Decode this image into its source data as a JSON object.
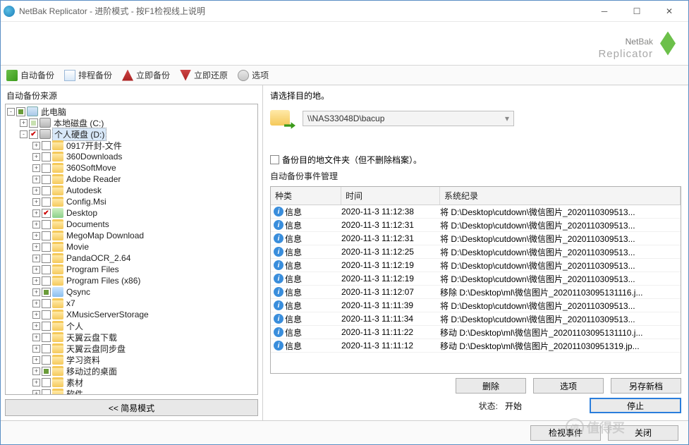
{
  "window": {
    "title": "NetBak Replicator - 进阶模式 - 按F1检视线上说明"
  },
  "brand": {
    "line1a": "Net",
    "line1b": "Bak",
    "line2": "Replicator"
  },
  "toolbar": {
    "auto": "自动备份",
    "sched": "排程备份",
    "now": "立即备份",
    "restore": "立即还原",
    "options": "选项"
  },
  "left": {
    "header": "自动备份来源",
    "simple_button": "<< 简易模式",
    "tree": {
      "root": "此电脑",
      "drives": [
        {
          "label": "本地磁盘 (C:)",
          "exp": "+",
          "cb": "light"
        },
        {
          "label": "个人硬盘 (D:)",
          "exp": "-",
          "cb": "checked",
          "sel": true,
          "children": [
            {
              "label": "0917开封-文件",
              "cb": "",
              "icon": "folder"
            },
            {
              "label": "360Downloads",
              "cb": "",
              "icon": "folder"
            },
            {
              "label": "360SoftMove",
              "cb": "",
              "icon": "folder"
            },
            {
              "label": "Adobe Reader",
              "cb": "",
              "icon": "folder"
            },
            {
              "label": "Autodesk",
              "cb": "",
              "icon": "folder"
            },
            {
              "label": "Config.Msi",
              "cb": "",
              "icon": "folder"
            },
            {
              "label": "Desktop",
              "cb": "checked",
              "icon": "foldergreen"
            },
            {
              "label": "Documents",
              "cb": "",
              "icon": "folder"
            },
            {
              "label": "MegoMap Download",
              "cb": "",
              "icon": "folder"
            },
            {
              "label": "Movie",
              "cb": "",
              "icon": "folder"
            },
            {
              "label": "PandaOCR_2.64",
              "cb": "",
              "icon": "folder"
            },
            {
              "label": "Program Files",
              "cb": "",
              "icon": "folder"
            },
            {
              "label": "Program Files (x86)",
              "cb": "",
              "icon": "folder"
            },
            {
              "label": "Qsync",
              "cb": "square",
              "icon": "folderblue"
            },
            {
              "label": "x7",
              "cb": "",
              "icon": "folder"
            },
            {
              "label": "XMusicServerStorage",
              "cb": "",
              "icon": "folder"
            },
            {
              "label": "个人",
              "cb": "",
              "icon": "folder"
            },
            {
              "label": "天翼云盘下载",
              "cb": "",
              "icon": "folder"
            },
            {
              "label": "天翼云盘同步盘",
              "cb": "",
              "icon": "folder"
            },
            {
              "label": "学习资料",
              "cb": "",
              "icon": "folder"
            },
            {
              "label": "移动过的桌面",
              "cb": "square",
              "icon": "folder"
            },
            {
              "label": "素材",
              "cb": "",
              "icon": "folder"
            },
            {
              "label": "软件",
              "cb": "",
              "icon": "folder"
            }
          ]
        }
      ]
    }
  },
  "right": {
    "dest_label": "请选择目的地。",
    "dest_path": "\\\\NAS33048D\\bacup",
    "mirror_checkbox": "备份目的地文件夹（但不删除档案）。",
    "events_label": "自动备份事件管理",
    "columns": {
      "kind": "种类",
      "time": "时间",
      "record": "系统纪录"
    },
    "rows": [
      {
        "kind": "信息",
        "time": "2020-11-3 11:12:38",
        "rec": "将 D:\\Desktop\\cutdown\\微信图片_2020110309513..."
      },
      {
        "kind": "信息",
        "time": "2020-11-3 11:12:31",
        "rec": "将 D:\\Desktop\\cutdown\\微信图片_2020110309513..."
      },
      {
        "kind": "信息",
        "time": "2020-11-3 11:12:31",
        "rec": "将 D:\\Desktop\\cutdown\\微信图片_2020110309513..."
      },
      {
        "kind": "信息",
        "time": "2020-11-3 11:12:25",
        "rec": "将 D:\\Desktop\\cutdown\\微信图片_2020110309513..."
      },
      {
        "kind": "信息",
        "time": "2020-11-3 11:12:19",
        "rec": "将 D:\\Desktop\\cutdown\\微信图片_2020110309513..."
      },
      {
        "kind": "信息",
        "time": "2020-11-3 11:12:19",
        "rec": "将 D:\\Desktop\\cutdown\\微信图片_2020110309513..."
      },
      {
        "kind": "信息",
        "time": "2020-11-3 11:12:07",
        "rec": "移除 D:\\Desktop\\ml\\微信图片_20201103095131116.j..."
      },
      {
        "kind": "信息",
        "time": "2020-11-3 11:11:39",
        "rec": "将 D:\\Desktop\\cutdown\\微信图片_2020110309513..."
      },
      {
        "kind": "信息",
        "time": "2020-11-3 11:11:34",
        "rec": "将 D:\\Desktop\\cutdown\\微信图片_2020110309513..."
      },
      {
        "kind": "信息",
        "time": "2020-11-3 11:11:22",
        "rec": "移动 D:\\Desktop\\ml\\微信图片_20201103095131110.j..."
      },
      {
        "kind": "信息",
        "time": "2020-11-3 11:11:12",
        "rec": "移动 D:\\Desktop\\ml\\微信图片_202011030951319.jp..."
      }
    ],
    "delete_btn": "删除",
    "opt_btn": "选项",
    "new_btn": "另存新档",
    "status_label": "状态:",
    "status_value": "开始",
    "stop_btn": "停止"
  },
  "bottom": {
    "review": "检视事件",
    "close": "关闭",
    "watermark": "值得买"
  }
}
